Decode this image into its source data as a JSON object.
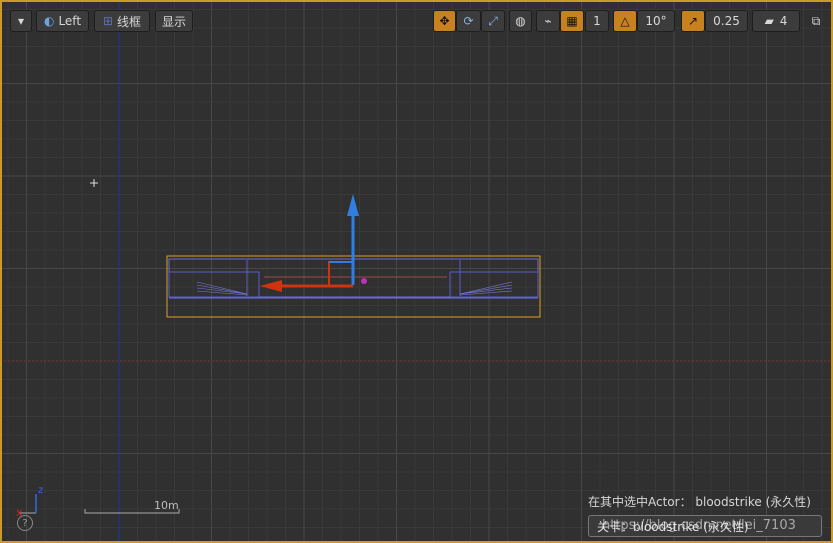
{
  "toolbar": {
    "menu_icon": "chevron-down-icon",
    "view_left_label": "Left",
    "wireframe_label": "线框",
    "show_label": "显示",
    "grid_snap_value": "1",
    "rotation_snap_value": "10°",
    "scale_snap_value": "0.25",
    "camera_speed_value": "4"
  },
  "status": {
    "selection_text": "在其中选中Actor：  bloodstrike (永久性)",
    "level_text": "关卡：bloodstrike (永久性)",
    "watermark": "https://blog.csdn.net/lei_7103"
  },
  "scale": {
    "label": "10m"
  },
  "colors": {
    "border": "#c89b2a",
    "active_button": "#c8821d",
    "grid_minor": "#3a3a3a",
    "grid_major": "#444444",
    "axis_blue": "#1a2fbf",
    "axis_red": "#7a1c1c",
    "gizmo_up": "#2f7fe0",
    "gizmo_left": "#d0340c",
    "selection": "#e0a020",
    "mesh": "#6b6bd8"
  }
}
